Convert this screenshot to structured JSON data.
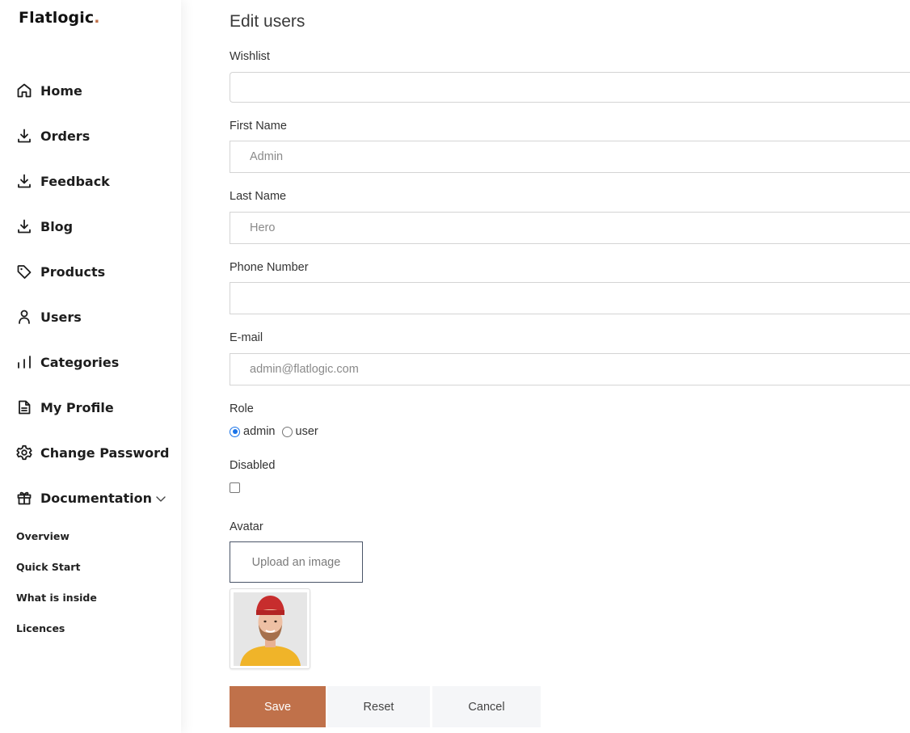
{
  "app": {
    "logo_text": "Flatlogic",
    "logo_dot": ".",
    "accent_color": "#c0714a"
  },
  "sidebar": {
    "items": [
      {
        "label": "Home",
        "icon": "home-icon"
      },
      {
        "label": "Orders",
        "icon": "download-icon"
      },
      {
        "label": "Feedback",
        "icon": "download-icon"
      },
      {
        "label": "Blog",
        "icon": "download-icon"
      },
      {
        "label": "Products",
        "icon": "tag-icon"
      },
      {
        "label": "Users",
        "icon": "user-icon"
      },
      {
        "label": "Categories",
        "icon": "bar-chart-icon"
      },
      {
        "label": "My Profile",
        "icon": "document-icon"
      },
      {
        "label": "Change Password",
        "icon": "settings-icon"
      },
      {
        "label": "Documentation",
        "icon": "gift-icon"
      }
    ],
    "documentation_subitems": [
      "Overview",
      "Quick Start",
      "What is inside",
      "Licences"
    ]
  },
  "form": {
    "title": "Edit users",
    "wishlist": {
      "label": "Wishlist",
      "value": ""
    },
    "first_name": {
      "label": "First Name",
      "value": "Admin"
    },
    "last_name": {
      "label": "Last Name",
      "value": "Hero"
    },
    "phone": {
      "label": "Phone Number",
      "value": ""
    },
    "email": {
      "label": "E-mail",
      "value": "admin@flatlogic.com"
    },
    "role": {
      "label": "Role",
      "options": [
        "admin",
        "user"
      ],
      "selected": "admin"
    },
    "disabled": {
      "label": "Disabled",
      "checked": false
    },
    "avatar": {
      "label": "Avatar",
      "upload_label": "Upload an image"
    },
    "buttons": {
      "save": "Save",
      "reset": "Reset",
      "cancel": "Cancel"
    }
  }
}
